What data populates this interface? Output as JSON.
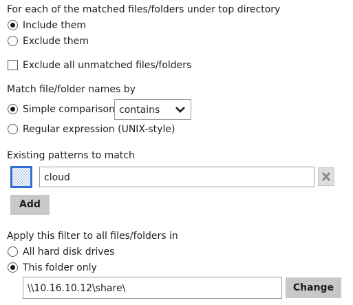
{
  "matched": {
    "heading": "For each of the matched files/folders under top directory",
    "options": [
      {
        "label": "Include them",
        "selected": true
      },
      {
        "label": "Exclude them",
        "selected": false
      }
    ]
  },
  "unmatched": {
    "label": "Exclude all unmatched files/folders",
    "checked": false
  },
  "match_by": {
    "heading": "Match file/folder names by",
    "simple_label": "Simple comparison",
    "simple_selected": true,
    "comparison_value": "contains",
    "regex_label": "Regular expression (UNIX-style)",
    "regex_selected": false
  },
  "patterns": {
    "heading": "Existing patterns to match",
    "items": [
      {
        "value": "cloud",
        "icon": "pattern-icon"
      }
    ],
    "remove_icon": "close-icon",
    "add_label": "Add"
  },
  "apply": {
    "heading": "Apply this filter to all files/folders in",
    "options": [
      {
        "label": "All hard disk drives",
        "selected": false
      },
      {
        "label": "This folder only",
        "selected": true
      }
    ],
    "folder_path": "\\\\10.16.10.12\\share\\",
    "change_label": "Change"
  },
  "colors": {
    "accent_blue": "#2f6fd6",
    "button_gray": "#c8c8c8"
  }
}
